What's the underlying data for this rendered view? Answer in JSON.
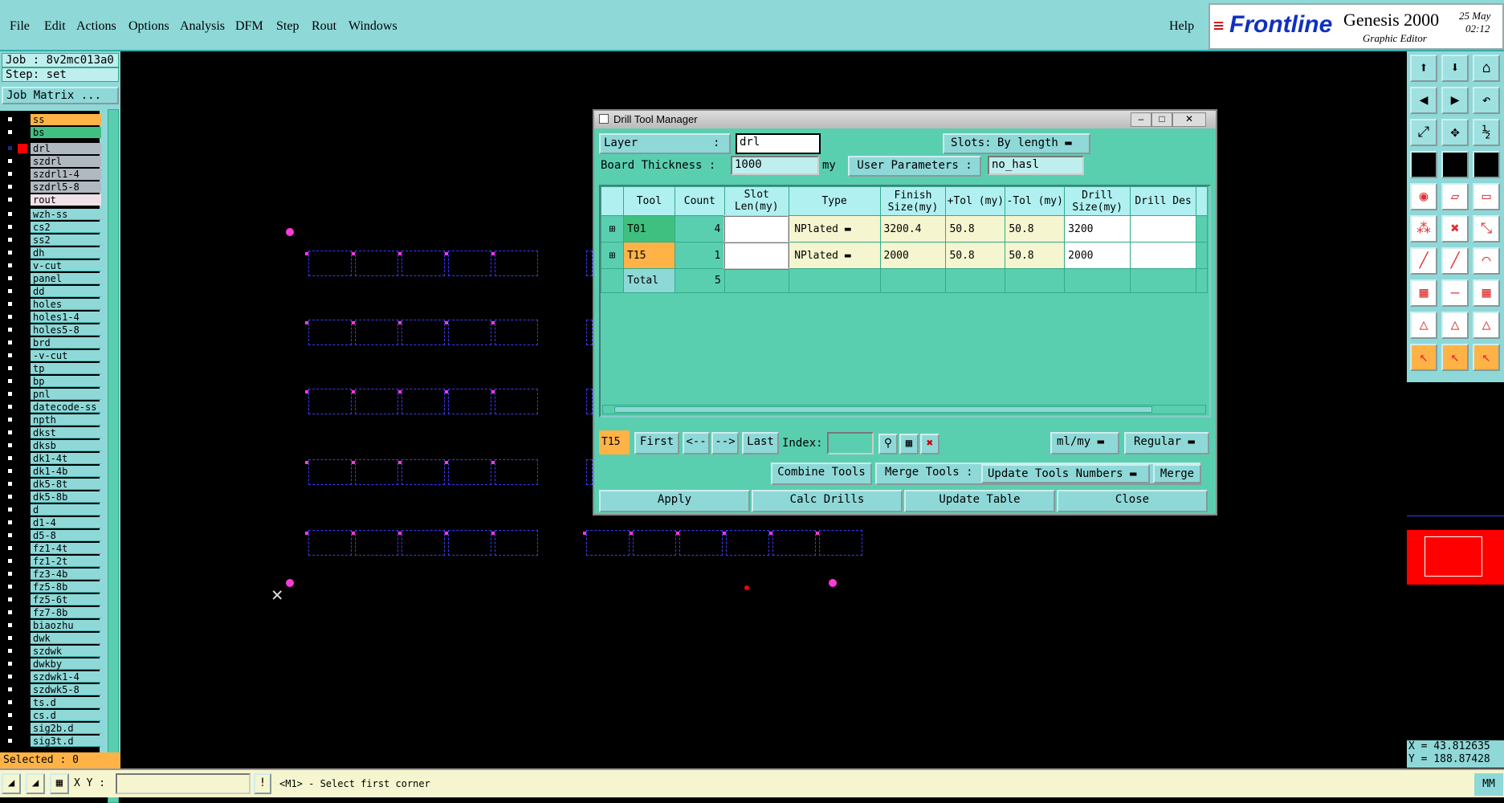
{
  "menubar": {
    "items": [
      "File",
      "Edit",
      "Actions",
      "Options",
      "Analysis",
      "DFM",
      "Step",
      "Rout",
      "Windows"
    ],
    "help": "Help",
    "brand": "Frontline",
    "product": "Genesis 2000",
    "subtitle": "Graphic Editor",
    "date": "25 May",
    "time": "02:12"
  },
  "left": {
    "job": "Job : 8v2mc013a0",
    "step": "Step: set",
    "matrix_btn": "Job Matrix ...",
    "layers_top": [
      {
        "name": "ss",
        "style": "orange"
      },
      {
        "name": "bs",
        "style": "green"
      },
      {
        "name": "drl",
        "style": "sel"
      },
      {
        "name": "szdrl",
        "style": "gray"
      },
      {
        "name": "szdrl1-4",
        "style": "gray"
      },
      {
        "name": "szdrl5-8",
        "style": "gray"
      },
      {
        "name": "rout",
        "style": "pink"
      }
    ],
    "layers": [
      "wzh-ss",
      "cs2",
      "ss2",
      "dh",
      "v-cut",
      "panel",
      "dd",
      "holes",
      "holes1-4",
      "holes5-8",
      "brd",
      "-v-cut",
      "tp",
      "bp",
      "pnl",
      "datecode-ss",
      "npth",
      "dkst",
      "dksb",
      "dk1-4t",
      "dk1-4b",
      "dk5-8t",
      "dk5-8b",
      "d",
      "d1-4",
      "d5-8",
      "fz1-4t",
      "fz1-2t",
      "fz3-4b",
      "fz5-8b",
      "fz5-6t",
      "fz7-8b",
      "biaozhu",
      "dwk",
      "szdwk",
      "dwkby",
      "szdwk1-4",
      "szdwk5-8",
      "ts.d",
      "cs.d",
      "sig2b.d",
      "sig3t.d"
    ],
    "selected": "Selected : 0"
  },
  "dialog": {
    "title": "Drill Tool Manager",
    "layer_label": "Layer",
    "layer_colon": ":",
    "layer_value": "drl",
    "slots_label": "Slots:",
    "slots_value": "By length",
    "thickness_label": "Board Thickness :",
    "thickness_value": "1000",
    "thickness_unit": "my",
    "user_params_label": "User Parameters :",
    "user_params_value": "no_hasl",
    "columns": [
      "Tool",
      "Count",
      "Slot Len(my)",
      "Type",
      "Finish Size(my)",
      "+Tol (my)",
      "-Tol (my)",
      "Drill Size(my)",
      "Drill Des"
    ],
    "rows": [
      {
        "tool": "T01",
        "count": "4",
        "slot": "",
        "type": "NPlated",
        "finish": "3200.4",
        "ptol": "50.8",
        "ntol": "50.8",
        "drill": "3200",
        "des": ""
      },
      {
        "tool": "T15",
        "count": "1",
        "slot": "",
        "type": "NPlated",
        "finish": "2000",
        "ptol": "50.8",
        "ntol": "50.8",
        "drill": "2000",
        "des": ""
      }
    ],
    "total_label": "Total",
    "total_count": "5",
    "current_tool": "T15",
    "nav": {
      "first": "First",
      "prev": "<--",
      "next": "-->",
      "last": "Last",
      "index": "Index:"
    },
    "units": "ml/my",
    "mode": "Regular",
    "combine": "Combine Tools",
    "merge_label": "Merge Tools :",
    "merge_option": "Update Tools Numbers",
    "merge_btn": "Merge",
    "apply": "Apply",
    "calc": "Calc Drills",
    "update_table": "Update Table",
    "close": "Close"
  },
  "coords": {
    "x": "X = 43.812635",
    "y": "Y = 188.87428"
  },
  "status": {
    "xy_label": "X Y :",
    "message": "<M1> - Select first corner",
    "unit": "MM"
  },
  "colors": {
    "panel": "#8fd8d8",
    "dialog": "#5acfb0",
    "accent": "#ffb347",
    "canvas": "#000000",
    "marker": "#ff3ad8"
  }
}
